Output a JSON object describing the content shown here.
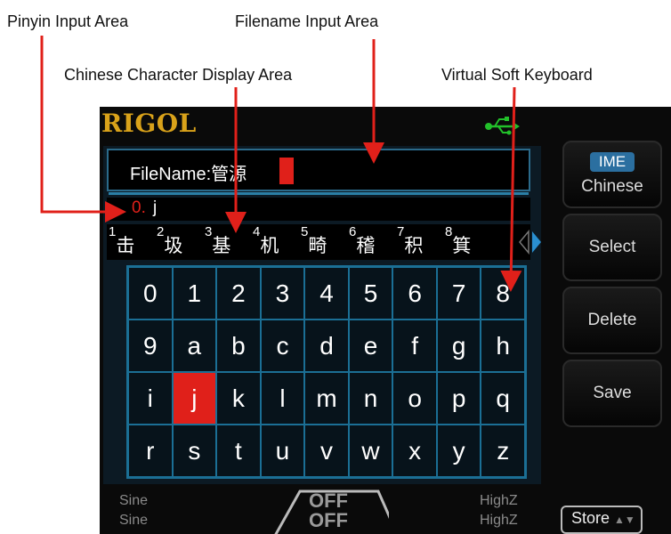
{
  "callouts": {
    "pinyin": "Pinyin Input Area",
    "filename": "Filename Input Area",
    "chinese": "Chinese Character Display Area",
    "keyboard": "Virtual Soft Keyboard"
  },
  "header": {
    "logo": "RIGOL",
    "usb_icon": "usb-icon"
  },
  "filename": {
    "label": "FileName:",
    "value": "管源"
  },
  "pinyin": {
    "index": "0.",
    "text": "j"
  },
  "candidates": [
    {
      "n": "1",
      "c": "击"
    },
    {
      "n": "2",
      "c": "圾"
    },
    {
      "n": "3",
      "c": "基"
    },
    {
      "n": "4",
      "c": "机"
    },
    {
      "n": "5",
      "c": "畸"
    },
    {
      "n": "6",
      "c": "稽"
    },
    {
      "n": "7",
      "c": "积"
    },
    {
      "n": "8",
      "c": "箕"
    }
  ],
  "keyboard": {
    "keys": [
      "0",
      "1",
      "2",
      "3",
      "4",
      "5",
      "6",
      "7",
      "8",
      "9",
      "a",
      "b",
      "c",
      "d",
      "e",
      "f",
      "g",
      "h",
      "i",
      "j",
      "k",
      "l",
      "m",
      "n",
      "o",
      "p",
      "q",
      "r",
      "s",
      "t",
      "u",
      "v",
      "w",
      "x",
      "y",
      "z"
    ],
    "selected": "j"
  },
  "softkeys": {
    "ime_top": "IME",
    "ime_bottom": "Chinese",
    "select": "Select",
    "delete": "Delete",
    "save": "Save"
  },
  "bottom": {
    "ch1_wave": "Sine",
    "ch2_wave": "Sine",
    "ch1_out": "OFF",
    "ch2_out": "OFF",
    "ch1_load": "HighZ",
    "ch2_load": "HighZ",
    "store": "Store"
  },
  "colors": {
    "accent_red": "#e0201a",
    "logo_gold": "#d9a21a",
    "frame_blue": "#1b6f95"
  }
}
